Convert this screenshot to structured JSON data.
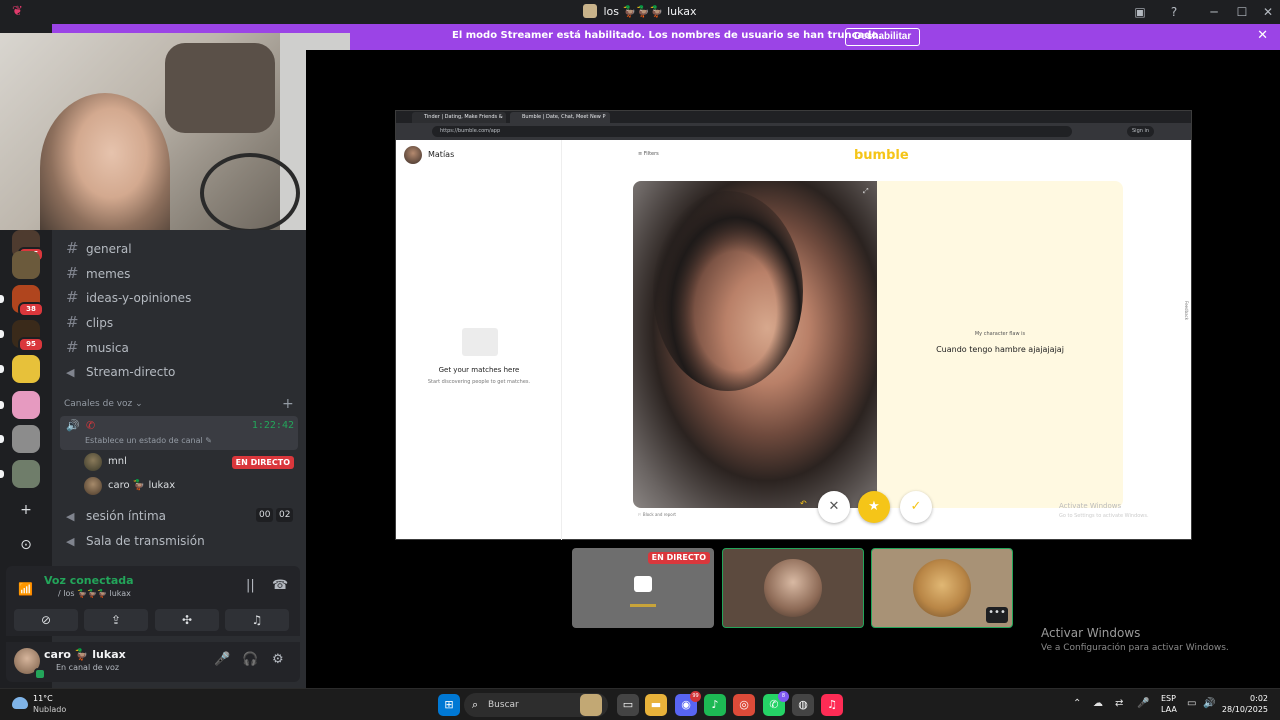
{
  "window": {
    "title": "los 🦆🦆🦆 lukax",
    "logo_glyph": "❦",
    "inbox_glyph": "▣",
    "help_glyph": "?",
    "min_glyph": "─",
    "max_glyph": "☐",
    "close_glyph": "✕"
  },
  "banner": {
    "text": "El modo Streamer está habilitado. Los nombres de usuario se han truncado.",
    "button": "Deshabilitar",
    "close_glyph": "✕"
  },
  "servers": [
    {
      "badge": "185",
      "color": "#4e3b2f",
      "pill": false
    },
    {
      "badge": "",
      "color": "#6b5a3c",
      "pill": false
    },
    {
      "badge": "38",
      "color": "#b0451e",
      "pill": true
    },
    {
      "badge": "95",
      "color": "#3a2a1a",
      "pill": true
    },
    {
      "badge": "",
      "color": "#e7c13a",
      "pill": true
    },
    {
      "badge": "",
      "color": "#e69ac0",
      "pill": true
    },
    {
      "badge": "",
      "color": "#8c8c8c",
      "pill": true
    },
    {
      "badge": "",
      "color": "#6f7d6a",
      "pill": true
    }
  ],
  "rail_actions": {
    "add": "+",
    "explore": "⊙"
  },
  "text_channels": [
    {
      "name": "general"
    },
    {
      "name": "memes"
    },
    {
      "name": "ideas-y-opiniones"
    },
    {
      "name": "clips"
    },
    {
      "name": "musica"
    }
  ],
  "stage_channel": {
    "name": "Stream-directo"
  },
  "voice_category": {
    "label": "Canales de voz",
    "add": "+"
  },
  "active_voice": {
    "timer": "1:22:42",
    "status": "Establece un estado de canal ✎",
    "phone_glyph": "✆",
    "speaker_glyph": "🔊",
    "members": [
      {
        "name": "mnl",
        "live": "EN DIRECTO"
      },
      {
        "name": "caro 🦆 lukax",
        "live": ""
      }
    ]
  },
  "other_voice": [
    {
      "name": "sesión íntima",
      "counts": [
        "00",
        "02"
      ]
    },
    {
      "name": "Sala de transmisión",
      "counts": []
    }
  ],
  "voice_panel": {
    "title": "Voz conectada",
    "sub": "/ los 🦆🦆🦆 lukax",
    "signal_glyph": "📶",
    "noise_glyph": "||",
    "disconnect_glyph": "☎",
    "buttons": [
      {
        "name": "camera",
        "glyph": "⊘"
      },
      {
        "name": "screen-share",
        "glyph": "⇪"
      },
      {
        "name": "activities",
        "glyph": "✣"
      },
      {
        "name": "soundboard",
        "glyph": "♫"
      }
    ]
  },
  "user": {
    "name": "caro 🦆 lukax",
    "status": "En canal de voz",
    "mic_glyph": "🎤",
    "headset_glyph": "🎧",
    "settings_glyph": "⚙"
  },
  "browser": {
    "tabs": [
      "Tinder | Dating, Make Friends & M",
      "Bumble | Date, Chat, Meet New P"
    ],
    "url": "https://bumble.com/app",
    "signin": "Sign in"
  },
  "bumble": {
    "username": "Matías",
    "filters": "Filters",
    "logo": "bumble",
    "empty_title": "Get your matches here",
    "empty_sub": "Start discovering people to get matches.",
    "prompt_label": "My character flaw is",
    "prompt_text": "Cuando tengo hambre ajajajajaj",
    "block": "Block and report",
    "feedback": "Feedback",
    "watermark1": "Activate Windows",
    "watermark2": "Go to Settings to activate Windows.",
    "actions": {
      "pass": "✕",
      "superswipe": "★",
      "like": "✓",
      "back": "↶"
    }
  },
  "tiles": [
    {
      "live": "EN DIRECTO",
      "bg": "#6e6e6e"
    },
    {
      "live": "",
      "bg": "#5c4a3e"
    },
    {
      "live": "",
      "bg": "#a89276",
      "more": "•••"
    }
  ],
  "activation": {
    "line1": "Activar Windows",
    "line2": "Ve a Configuración para activar Windows."
  },
  "taskbar": {
    "temp": "11°C",
    "weather": "Nublado",
    "search": "Buscar",
    "search_glyph": "⌕",
    "lang1": "ESP",
    "lang2": "LAA",
    "time": "0:02",
    "date": "28/10/2025",
    "tray": [
      "⌃",
      "☁",
      "⇄",
      "🎤",
      "▭",
      "🔊"
    ],
    "apps": [
      {
        "name": "start",
        "glyph": "⊞",
        "color": "#0078d4",
        "badge": ""
      },
      {
        "name": "discord",
        "glyph": "◉",
        "color": "#5865f2",
        "badge": "99"
      },
      {
        "name": "spotify",
        "glyph": "♪",
        "color": "#1db954",
        "badge": ""
      },
      {
        "name": "chrome",
        "glyph": "◎",
        "color": "#dd4b39",
        "badge": ""
      },
      {
        "name": "whatsapp",
        "glyph": "✆",
        "color": "#25d366",
        "badge": "8"
      },
      {
        "name": "obs",
        "glyph": "◍",
        "color": "#444444",
        "badge": ""
      },
      {
        "name": "tiktok",
        "glyph": "♫",
        "color": "#fe2c55",
        "badge": ""
      }
    ]
  },
  "colors": {
    "banner": "#9b44e6",
    "green": "#23a55a",
    "live": "#da373c",
    "bumble_yellow": "#f5c518"
  }
}
